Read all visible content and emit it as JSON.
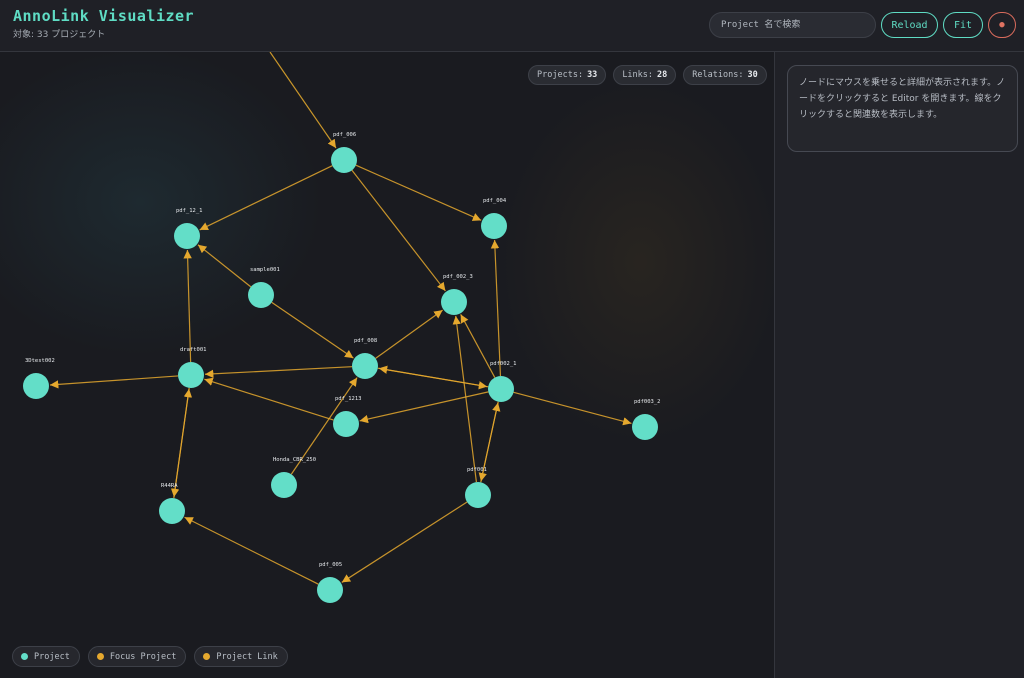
{
  "header": {
    "title": "AnnoLink Visualizer",
    "subtitle": "対象: 33 プロジェクト",
    "search_placeholder": "Project 名で検索",
    "reload_label": "Reload",
    "fit_label": "Fit",
    "close_label": "●"
  },
  "stats": {
    "projects_label": "Projects:",
    "projects_value": "33",
    "links_label": "Links:",
    "links_value": "28",
    "relations_label": "Relations:",
    "relations_value": "30"
  },
  "legend": {
    "project": "Project",
    "focus_project": "Focus Project",
    "project_link": "Project Link"
  },
  "sidebar": {
    "hint": "ノードにマウスを乗せると詳細が表示されます。ノードをクリックすると Editor を開きます。線をクリックすると関連数を表示します。"
  },
  "colors": {
    "accent": "#5fdcc4",
    "node": "#63dec8",
    "edge": "#e5a82e",
    "close": "#e07362"
  },
  "graph": {
    "nodes": [
      {
        "id": "pdf_006",
        "label": "pdf_006"
      },
      {
        "id": "pdf_12_1",
        "label": "pdf_12_1"
      },
      {
        "id": "pdf_004",
        "label": "pdf_004"
      },
      {
        "id": "sample001",
        "label": "sample001"
      },
      {
        "id": "pdf_002_3",
        "label": "pdf_002_3"
      },
      {
        "id": "pdf_008",
        "label": "pdf_008"
      },
      {
        "id": "draft001",
        "label": "draft001"
      },
      {
        "id": "3Dtest002",
        "label": "3Dtest002"
      },
      {
        "id": "pdf002_1",
        "label": "pdf002_1"
      },
      {
        "id": "pdf_1213",
        "label": "pdf_1213"
      },
      {
        "id": "pdf003_2",
        "label": "pdf003_2"
      },
      {
        "id": "Honda_CBR_250",
        "label": "Honda_CBR_250"
      },
      {
        "id": "pdf001",
        "label": "pdf001"
      },
      {
        "id": "R44RA",
        "label": "R44RA"
      },
      {
        "id": "pdf_005",
        "label": "pdf_005"
      }
    ],
    "edges": [
      {
        "from": "pdf_006",
        "to": "pdf_12_1"
      },
      {
        "from": "pdf_006",
        "to": "pdf_004"
      },
      {
        "from": "pdf_006",
        "to": "pdf_002_3"
      },
      {
        "from": "sample001",
        "to": "pdf_12_1"
      },
      {
        "from": "sample001",
        "to": "pdf_008"
      },
      {
        "from": "draft001",
        "to": "pdf_12_1"
      },
      {
        "from": "draft001",
        "to": "3Dtest002"
      },
      {
        "from": "pdf_008",
        "to": "draft001"
      },
      {
        "from": "pdf_008",
        "to": "pdf_002_3"
      },
      {
        "from": "pdf_008",
        "to": "pdf002_1"
      },
      {
        "from": "pdf002_1",
        "to": "pdf_008"
      },
      {
        "from": "pdf002_1",
        "to": "pdf_004"
      },
      {
        "from": "pdf002_1",
        "to": "pdf_002_3"
      },
      {
        "from": "pdf002_1",
        "to": "pdf003_2"
      },
      {
        "from": "pdf002_1",
        "to": "pdf_1213"
      },
      {
        "from": "pdf002_1",
        "to": "pdf001"
      },
      {
        "from": "pdf_1213",
        "to": "draft001"
      },
      {
        "from": "Honda_CBR_250",
        "to": "pdf_008"
      },
      {
        "from": "pdf001",
        "to": "pdf_002_3"
      },
      {
        "from": "pdf001",
        "to": "pdf002_1"
      },
      {
        "from": "pdf001",
        "to": "pdf_005"
      },
      {
        "from": "R44RA",
        "to": "draft001"
      },
      {
        "from": "draft001",
        "to": "R44RA"
      },
      {
        "from": "pdf_005",
        "to": "R44RA"
      }
    ]
  }
}
